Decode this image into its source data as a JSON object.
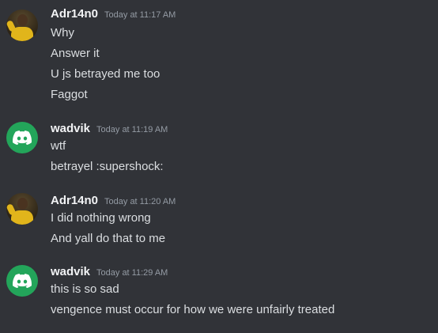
{
  "messages": [
    {
      "author": "Adr14n0",
      "timestamp": "Today at 11:17 AM",
      "avatar": "photo-avatar",
      "lines": [
        "Why",
        "Answer it",
        "U js betrayed me too",
        "Faggot"
      ]
    },
    {
      "author": "wadvik",
      "timestamp": "Today at 11:19 AM",
      "avatar": "discord-logo-avatar",
      "avatar_color": "#23a55a",
      "lines": [
        "wtf",
        "betrayel :supershock:"
      ]
    },
    {
      "author": "Adr14n0",
      "timestamp": "Today at 11:20 AM",
      "avatar": "photo-avatar",
      "lines": [
        "I did nothing wrong",
        "And yall do that to me"
      ]
    },
    {
      "author": "wadvik",
      "timestamp": "Today at 11:29 AM",
      "avatar": "discord-logo-avatar",
      "avatar_color": "#23a55a",
      "lines": [
        "this is so sad",
        "vengence must occur for how we were unfairly treated"
      ]
    }
  ],
  "colors": {
    "background": "#313338",
    "username": "#f2f3f5",
    "message_text": "#dbdee1",
    "timestamp": "#949ba4"
  }
}
